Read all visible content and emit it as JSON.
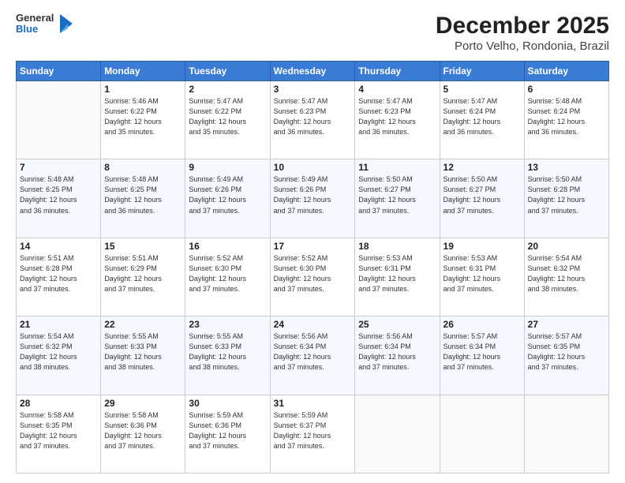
{
  "header": {
    "logo": {
      "line1": "General",
      "line2": "Blue"
    },
    "title": "December 2025",
    "subtitle": "Porto Velho, Rondonia, Brazil"
  },
  "days_of_week": [
    "Sunday",
    "Monday",
    "Tuesday",
    "Wednesday",
    "Thursday",
    "Friday",
    "Saturday"
  ],
  "weeks": [
    [
      {
        "num": "",
        "info": ""
      },
      {
        "num": "1",
        "info": "Sunrise: 5:46 AM\nSunset: 6:22 PM\nDaylight: 12 hours\nand 35 minutes."
      },
      {
        "num": "2",
        "info": "Sunrise: 5:47 AM\nSunset: 6:22 PM\nDaylight: 12 hours\nand 35 minutes."
      },
      {
        "num": "3",
        "info": "Sunrise: 5:47 AM\nSunset: 6:23 PM\nDaylight: 12 hours\nand 36 minutes."
      },
      {
        "num": "4",
        "info": "Sunrise: 5:47 AM\nSunset: 6:23 PM\nDaylight: 12 hours\nand 36 minutes."
      },
      {
        "num": "5",
        "info": "Sunrise: 5:47 AM\nSunset: 6:24 PM\nDaylight: 12 hours\nand 36 minutes."
      },
      {
        "num": "6",
        "info": "Sunrise: 5:48 AM\nSunset: 6:24 PM\nDaylight: 12 hours\nand 36 minutes."
      }
    ],
    [
      {
        "num": "7",
        "info": "Sunrise: 5:48 AM\nSunset: 6:25 PM\nDaylight: 12 hours\nand 36 minutes."
      },
      {
        "num": "8",
        "info": "Sunrise: 5:48 AM\nSunset: 6:25 PM\nDaylight: 12 hours\nand 36 minutes."
      },
      {
        "num": "9",
        "info": "Sunrise: 5:49 AM\nSunset: 6:26 PM\nDaylight: 12 hours\nand 37 minutes."
      },
      {
        "num": "10",
        "info": "Sunrise: 5:49 AM\nSunset: 6:26 PM\nDaylight: 12 hours\nand 37 minutes."
      },
      {
        "num": "11",
        "info": "Sunrise: 5:50 AM\nSunset: 6:27 PM\nDaylight: 12 hours\nand 37 minutes."
      },
      {
        "num": "12",
        "info": "Sunrise: 5:50 AM\nSunset: 6:27 PM\nDaylight: 12 hours\nand 37 minutes."
      },
      {
        "num": "13",
        "info": "Sunrise: 5:50 AM\nSunset: 6:28 PM\nDaylight: 12 hours\nand 37 minutes."
      }
    ],
    [
      {
        "num": "14",
        "info": "Sunrise: 5:51 AM\nSunset: 6:28 PM\nDaylight: 12 hours\nand 37 minutes."
      },
      {
        "num": "15",
        "info": "Sunrise: 5:51 AM\nSunset: 6:29 PM\nDaylight: 12 hours\nand 37 minutes."
      },
      {
        "num": "16",
        "info": "Sunrise: 5:52 AM\nSunset: 6:30 PM\nDaylight: 12 hours\nand 37 minutes."
      },
      {
        "num": "17",
        "info": "Sunrise: 5:52 AM\nSunset: 6:30 PM\nDaylight: 12 hours\nand 37 minutes."
      },
      {
        "num": "18",
        "info": "Sunrise: 5:53 AM\nSunset: 6:31 PM\nDaylight: 12 hours\nand 37 minutes."
      },
      {
        "num": "19",
        "info": "Sunrise: 5:53 AM\nSunset: 6:31 PM\nDaylight: 12 hours\nand 37 minutes."
      },
      {
        "num": "20",
        "info": "Sunrise: 5:54 AM\nSunset: 6:32 PM\nDaylight: 12 hours\nand 38 minutes."
      }
    ],
    [
      {
        "num": "21",
        "info": "Sunrise: 5:54 AM\nSunset: 6:32 PM\nDaylight: 12 hours\nand 38 minutes."
      },
      {
        "num": "22",
        "info": "Sunrise: 5:55 AM\nSunset: 6:33 PM\nDaylight: 12 hours\nand 38 minutes."
      },
      {
        "num": "23",
        "info": "Sunrise: 5:55 AM\nSunset: 6:33 PM\nDaylight: 12 hours\nand 38 minutes."
      },
      {
        "num": "24",
        "info": "Sunrise: 5:56 AM\nSunset: 6:34 PM\nDaylight: 12 hours\nand 37 minutes."
      },
      {
        "num": "25",
        "info": "Sunrise: 5:56 AM\nSunset: 6:34 PM\nDaylight: 12 hours\nand 37 minutes."
      },
      {
        "num": "26",
        "info": "Sunrise: 5:57 AM\nSunset: 6:34 PM\nDaylight: 12 hours\nand 37 minutes."
      },
      {
        "num": "27",
        "info": "Sunrise: 5:57 AM\nSunset: 6:35 PM\nDaylight: 12 hours\nand 37 minutes."
      }
    ],
    [
      {
        "num": "28",
        "info": "Sunrise: 5:58 AM\nSunset: 6:35 PM\nDaylight: 12 hours\nand 37 minutes."
      },
      {
        "num": "29",
        "info": "Sunrise: 5:58 AM\nSunset: 6:36 PM\nDaylight: 12 hours\nand 37 minutes."
      },
      {
        "num": "30",
        "info": "Sunrise: 5:59 AM\nSunset: 6:36 PM\nDaylight: 12 hours\nand 37 minutes."
      },
      {
        "num": "31",
        "info": "Sunrise: 5:59 AM\nSunset: 6:37 PM\nDaylight: 12 hours\nand 37 minutes."
      },
      {
        "num": "",
        "info": ""
      },
      {
        "num": "",
        "info": ""
      },
      {
        "num": "",
        "info": ""
      }
    ]
  ]
}
